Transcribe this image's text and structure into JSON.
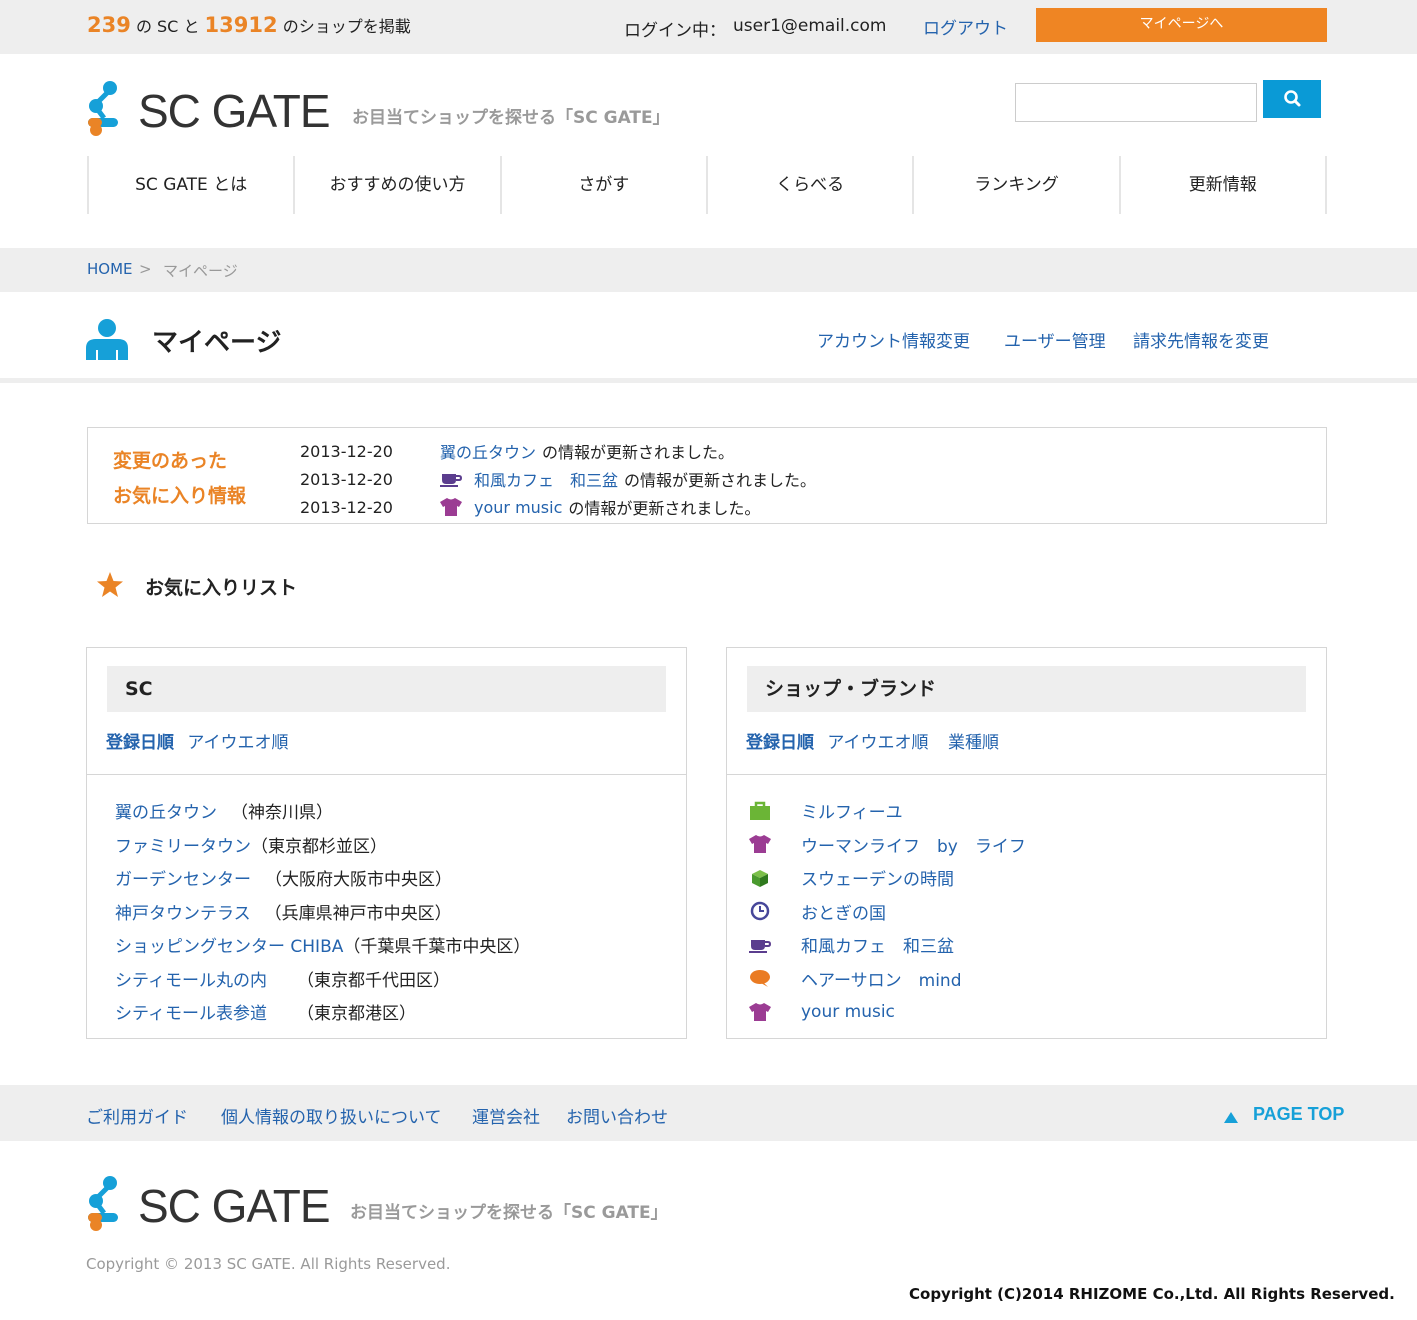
{
  "topbar": {
    "sc_count": "239",
    "sc_label": "の SC と",
    "shop_count": "13912",
    "shop_label": "のショップを掲載",
    "login_label": "ログイン中：",
    "login_email": "user1@email.com",
    "logout": "ログアウト",
    "mypage_button": "マイページへ"
  },
  "header": {
    "logo_text": "SC GATE",
    "tagline": "お目当てショップを探せる「SC GATE」",
    "search_value": "",
    "search_icon": "search-icon"
  },
  "nav": [
    "SC GATE とは",
    "おすすめの使い方",
    "さがす",
    "くらべる",
    "ランキング",
    "更新情報"
  ],
  "breadcrumb": {
    "home": "HOME",
    "sep": ">",
    "current": "マイページ"
  },
  "page": {
    "title": "マイページ",
    "links": [
      "アカウント情報変更",
      "ユーザー管理",
      "請求先情報を変更"
    ]
  },
  "updates": {
    "title_line1": "変更のあった",
    "title_line2": "お気に入り情報",
    "items": [
      {
        "date": "2013-12-20",
        "name": "翼の丘タウン",
        "text": "の情報が更新されました。",
        "icon": "none"
      },
      {
        "date": "2013-12-20",
        "name": "和風カフェ　和三盆",
        "text": "の情報が更新されました。",
        "icon": "cup-icon"
      },
      {
        "date": "2013-12-20",
        "name": "your music",
        "text": "の情報が更新されました。",
        "icon": "tshirt-icon"
      }
    ]
  },
  "favorites": {
    "title": "お気に入りリスト",
    "sc_panel": {
      "heading": "SC",
      "sorts": [
        "登録日順",
        "アイウエオ順"
      ],
      "items": [
        {
          "name": "翼の丘タウン",
          "pref": "（神奈川県）"
        },
        {
          "name": "ファミリータウン",
          "pref": "（東京都杉並区）"
        },
        {
          "name": "ガーデンセンター",
          "pref": "（大阪府大阪市中央区）"
        },
        {
          "name": "神戸タウンテラス",
          "pref": "（兵庫県神戸市中央区）"
        },
        {
          "name": "ショッピングセンター CHIBA",
          "pref": "（千葉県千葉市中央区）"
        },
        {
          "name": "シティモール丸の内",
          "pref": "（東京都千代田区）"
        },
        {
          "name": "シティモール表参道",
          "pref": "（東京都港区）"
        }
      ]
    },
    "shop_panel": {
      "heading": "ショップ・ブランド",
      "sorts": [
        "登録日順",
        "アイウエオ順",
        "業種順"
      ],
      "items": [
        {
          "name": "ミルフィーユ",
          "icon": "bag-icon",
          "color": "#6bb536"
        },
        {
          "name": "ウーマンライフ　by　ライフ",
          "icon": "tshirt-icon",
          "color": "#9b3c93"
        },
        {
          "name": "スウェーデンの時間",
          "icon": "cube-icon",
          "color": "#4a9a2e"
        },
        {
          "name": "おとぎの国",
          "icon": "clock-icon",
          "color": "#47479a"
        },
        {
          "name": "和風カフェ　和三盆",
          "icon": "cup-icon",
          "color": "#5b3d8e"
        },
        {
          "name": "ヘアーサロン　mind",
          "icon": "chat-icon",
          "color": "#ea7b22"
        },
        {
          "name": "your music",
          "icon": "tshirt-icon",
          "color": "#9b3c93"
        }
      ]
    }
  },
  "footer": {
    "links": [
      "ご利用ガイド",
      "個人情報の取り扱いについて",
      "運営会社",
      "お問い合わせ"
    ],
    "pagetop": "PAGE TOP",
    "logo_text": "SC GATE",
    "tagline": "お目当てショップを探せる「SC GATE」",
    "copyright": "Copyright ©  2013  SC GATE.   All Rights Reserved.",
    "copyright2": "Copyright (C)2014 RHIZOME Co.,Ltd. All Rights Reserved."
  },
  "colors": {
    "accent_orange": "#ea8426",
    "link_blue": "#2463ad",
    "search_blue": "#0a9ad6",
    "gray_bg": "#eeeeee"
  }
}
